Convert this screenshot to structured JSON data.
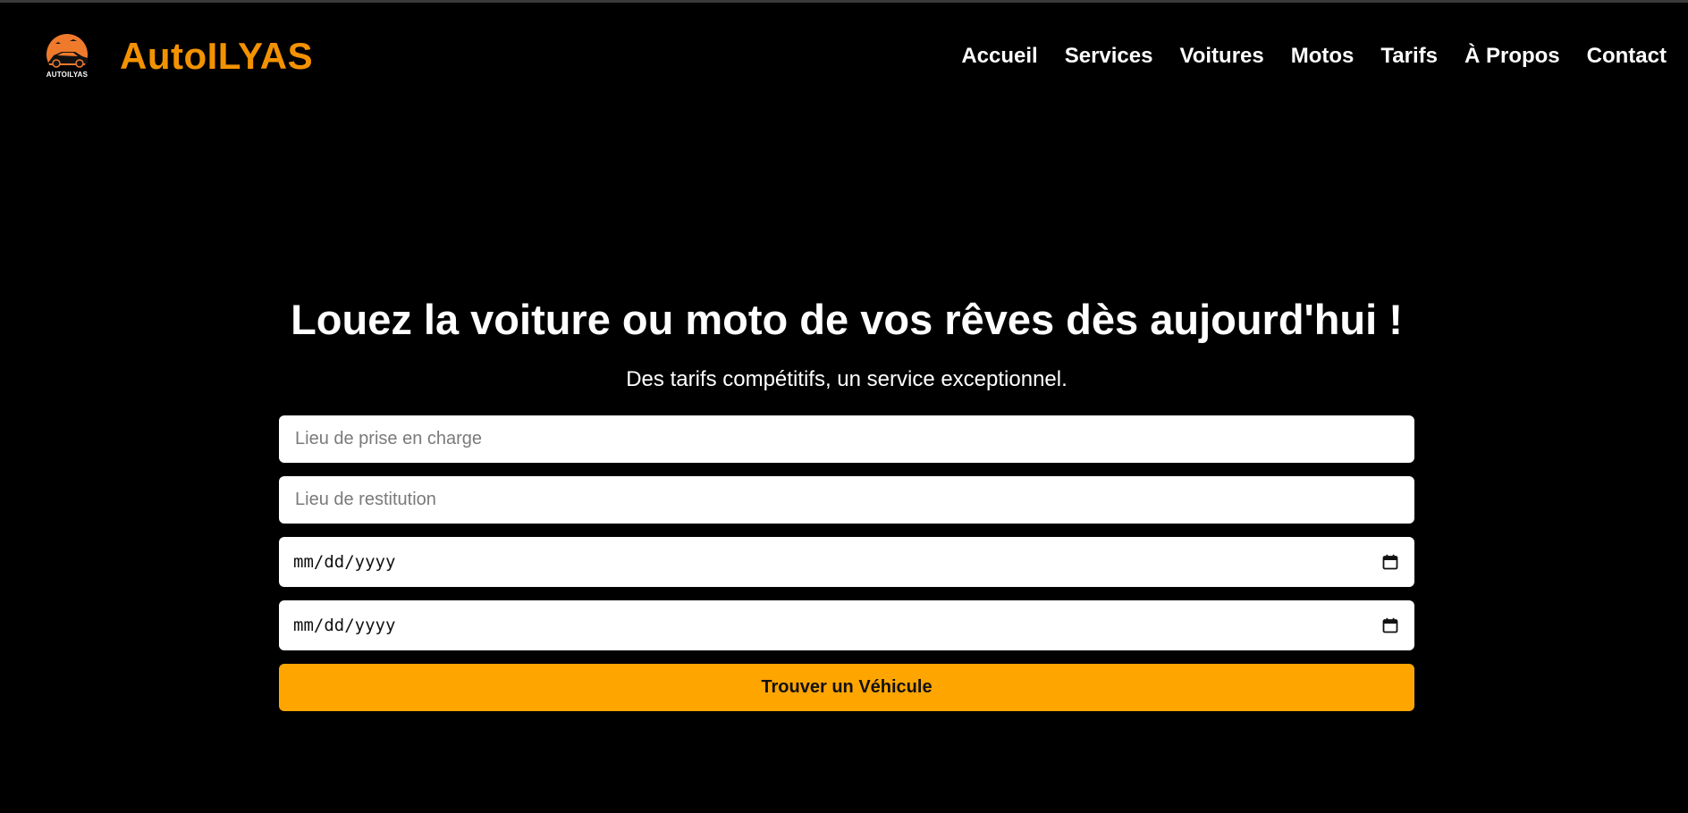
{
  "colors": {
    "accent": "#FFA500",
    "brand_name": "#F39200",
    "background": "#000000",
    "logo_circle": "#F07A2C"
  },
  "header": {
    "logo_text": "AUTOILYAS",
    "brand_name": "AutoILYAS",
    "nav": [
      {
        "label": "Accueil"
      },
      {
        "label": "Services"
      },
      {
        "label": "Voitures"
      },
      {
        "label": "Motos"
      },
      {
        "label": "Tarifs"
      },
      {
        "label": "À Propos"
      },
      {
        "label": "Contact"
      }
    ]
  },
  "hero": {
    "title": "Louez la voiture ou moto de vos rêves dès aujourd'hui !",
    "subtitle": "Des tarifs compétitifs, un service exceptionnel."
  },
  "form": {
    "pickup": {
      "placeholder": "Lieu de prise en charge",
      "value": ""
    },
    "return": {
      "placeholder": "Lieu de restitution",
      "value": ""
    },
    "start_date": {
      "value": "mm/dd/yyyy",
      "icon": "calendar-icon"
    },
    "end_date": {
      "value": "mm/dd/yyyy",
      "icon": "calendar-icon"
    },
    "submit_label": "Trouver un Véhicule"
  }
}
